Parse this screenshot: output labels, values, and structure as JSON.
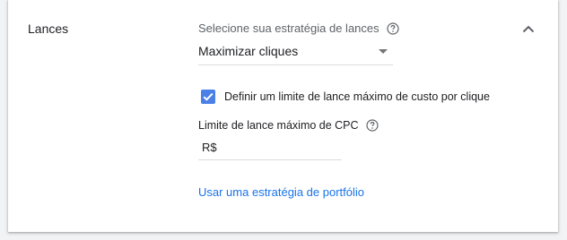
{
  "section": {
    "title": "Lances"
  },
  "strategy": {
    "label": "Selecione sua estratégia de lances",
    "selected": "Maximizar cliques"
  },
  "max_cpc_checkbox": {
    "checked": true,
    "label": "Definir um limite de lance máximo de custo por clique"
  },
  "max_cpc": {
    "label": "Limite de lance máximo de CPC",
    "currency": "R$",
    "value": ""
  },
  "portfolio_link": {
    "label": "Usar uma estratégia de portfólio"
  },
  "icons": {
    "help": "help-circle-icon",
    "collapse": "chevron-up-icon",
    "dropdown": "caret-down-icon",
    "checkmark": "check-icon"
  },
  "colors": {
    "accent": "#4a80e8",
    "link": "#1a73e8"
  }
}
